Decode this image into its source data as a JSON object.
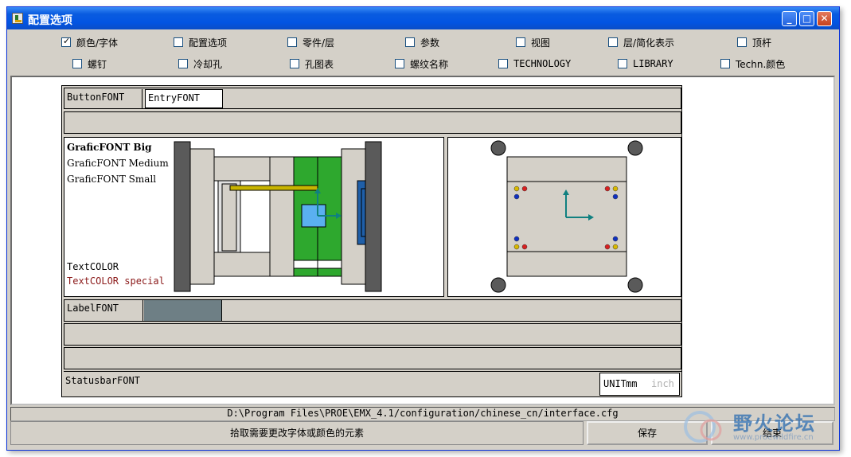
{
  "window": {
    "title": "配置选项",
    "controls": {
      "minimize": "_",
      "maximize": "□",
      "close": "✕"
    }
  },
  "options": [
    {
      "label": "颜色/字体",
      "checked": true
    },
    {
      "label": "配置选项",
      "checked": false
    },
    {
      "label": "零件/层",
      "checked": false
    },
    {
      "label": "参数",
      "checked": false
    },
    {
      "label": "视图",
      "checked": false
    },
    {
      "label": "层/简化表示",
      "checked": false
    },
    {
      "label": "顶杆",
      "checked": false
    },
    {
      "label": "螺钉",
      "checked": false
    },
    {
      "label": "冷却孔",
      "checked": false
    },
    {
      "label": "孔图表",
      "checked": false
    },
    {
      "label": "螺纹名称",
      "checked": false
    },
    {
      "label": "TECHNOLOGY",
      "checked": false
    },
    {
      "label": "LIBRARY",
      "checked": false
    },
    {
      "label": "Techn.颜色",
      "checked": false
    }
  ],
  "preview": {
    "button_font": "ButtonFONT",
    "entry_font": "EntryFONT",
    "grafic_big": "GraficFONT Big",
    "grafic_medium": "GraficFONT Medium",
    "grafic_small": "GraficFONT Small",
    "text_color": "TextCOLOR",
    "text_color_special": "TextCOLOR special",
    "label_font": "LabelFONT",
    "statusbar_font": "StatusbarFONT",
    "unit_label": "UNIT",
    "unit_mm": "mm",
    "unit_inch": "inch"
  },
  "colors": {
    "special_text": "#8b1a1a",
    "mold_green": "#2ea82e",
    "mold_blue": "#1f5fa8",
    "rod_yellow": "#c8b400",
    "arrow_teal": "#108080",
    "label_swatch": "#6e7f85",
    "inch_gray": "#b0b0b0"
  },
  "status": {
    "path": "D:\\Program Files\\PROE\\EMX_4.1/configuration/chinese_cn/interface.cfg",
    "hint": "拾取需要更改字体或颜色的元素"
  },
  "buttons": {
    "save": "保存",
    "finish": "结束"
  },
  "watermark": {
    "text": "野火论坛",
    "url": "www.proewildfire.cn"
  }
}
